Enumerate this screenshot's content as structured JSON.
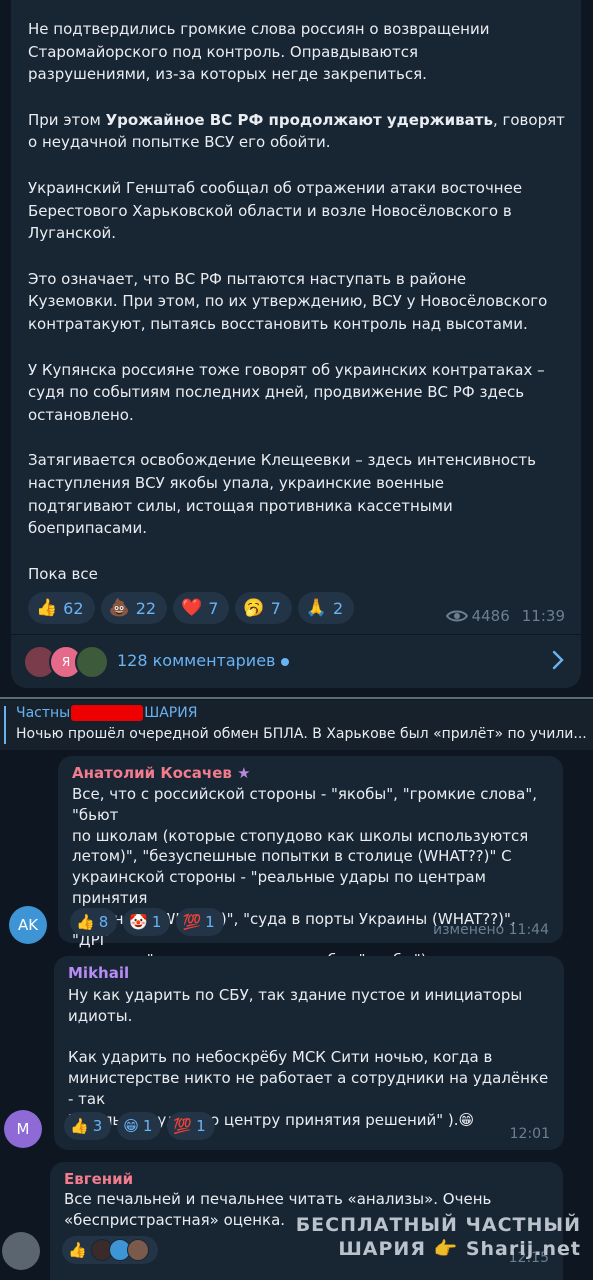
{
  "post": {
    "paragraphs": [
      {
        "text": "Не подтвердились громкие слова россиян о возвращении\nСтаромайорского под контроль. Оправдываются\nразрушениями, из-за которых негде закрепиться."
      },
      {
        "pre": "При этом ",
        "bold": "Урожайное ВС РФ продолжают удерживать",
        "post": ", говорят\nо неудачной попытке ВСУ его обойти."
      },
      {
        "text": "Украинский Генштаб сообщал об отражении атаки восточнее\nБерестового Харьковской области и возле Новосёловского в\nЛуганской."
      },
      {
        "text": "Это означает, что ВС РФ пытаются наступать в районе\nКуземовки. При этом, по их утверждению, ВСУ у Новосёловского\nконтратакуют, пытаясь восстановить контроль над высотами."
      },
      {
        "text": "У Купянска россияне тоже говорят об украинских контратаках –\nсудя по событиям последних дней, продвижение ВС РФ здесь\nостановлено."
      },
      {
        "text": "Затягивается освобождение Клещеевки – здесь интенсивность\nнаступления ВСУ якобы упала, украинские военные\nподтягивают силы, истощая противника кассетными\nбоеприпасами."
      },
      {
        "text": "Пока все"
      }
    ],
    "reactions": [
      {
        "emoji": "👍",
        "count": "62",
        "icon": "thumbs-up-icon"
      },
      {
        "emoji": "💩",
        "count": "22",
        "icon": "poop-icon"
      },
      {
        "emoji": "❤️",
        "count": "7",
        "icon": "heart-icon"
      },
      {
        "emoji": "🥱",
        "count": "7",
        "icon": "yawn-icon"
      },
      {
        "emoji": "🙏",
        "count": "2",
        "icon": "pray-icon"
      }
    ],
    "views": "4486",
    "time": "11:39",
    "comments_label": "128 комментариев",
    "commenter_avatars": [
      {
        "letter": "",
        "color": "#7a3b4a"
      },
      {
        "letter": "Я",
        "color": "#e56a8a"
      },
      {
        "letter": "",
        "color": "#3d5a3a"
      }
    ]
  },
  "pinned": {
    "title_left": "Частны",
    "title_right": "ШАРИЯ",
    "text": "Ночью прошёл очередной обмен БПЛА.   В Харькове был «прилёт» по учили..."
  },
  "comments": [
    {
      "author": "Анатолий Косачев",
      "author_color": "#f27c8d",
      "star": "★",
      "body": "Все, что с российской стороны - \"якобы\", \"громкие слова\", \"бьют\nпо школам (которые стопудово как школы используются\nлетом)\", \"безуспешные попытки в столице (WHAT??)\" С\nукраинской стороны - \"реальные удары по центрам принятия\nрешений\" (WHAT??)\", \"суда в порты Украины (WHAT??)\", \"ДРГ\nпрогнали\" и прочее, прочее, но без \"якобы\")",
      "reactions": [
        {
          "emoji": "👍",
          "count": "8",
          "icon": "thumbs-up-icon"
        },
        {
          "emoji": "🤡",
          "count": "1",
          "icon": "clown-icon"
        },
        {
          "emoji": "💯",
          "count": "1",
          "icon": "hundred-icon"
        }
      ],
      "time": "изменено 11:44",
      "avatar_text": "AK",
      "avatar_color": "#3e95d6"
    },
    {
      "author": "Mikhail",
      "author_color": "#b68cf5",
      "body": "Ну как ударить по СБУ, так здание пустое и инициаторы\nидиоты.\n\nКак ударить по небоскрёбу МСК Сити ночью, когда в\nминистерстве никто не работает а сотрудники на удалёнке - так\n\"реальный удар по центру принятия решений\" ).😁",
      "reactions": [
        {
          "emoji": "👍",
          "count": "3",
          "icon": "thumbs-up-icon"
        },
        {
          "emoji": "😁",
          "count": "1",
          "icon": "grin-icon"
        },
        {
          "emoji": "💯",
          "count": "1",
          "icon": "hundred-icon"
        }
      ],
      "time": "12:01",
      "avatar_text": "M",
      "avatar_color": "#8d6ad6"
    },
    {
      "author": "Евгений",
      "author_color": "#f27c8d",
      "body": "Все печальней и печальнее читать «анализы». Очень\n«беспристрастная» оценка.",
      "reactions": [
        {
          "emoji": "👍",
          "count": "",
          "icon": "thumbs-up-icon"
        }
      ],
      "time": "12:15"
    }
  ],
  "watermark": {
    "line1": "БЕСПЛАТНЫЙ ЧАСТНЫЙ",
    "line2": "ШАРИЯ 👉 Sharij.net"
  }
}
